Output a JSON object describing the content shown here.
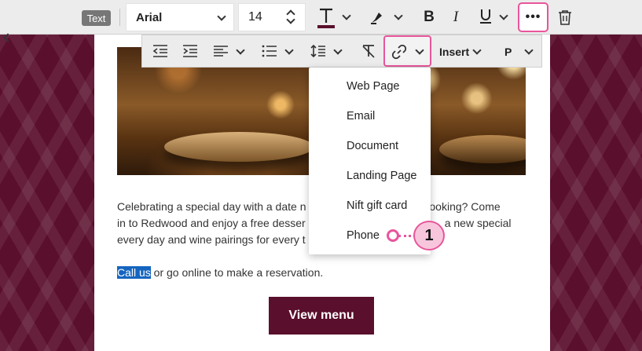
{
  "toolbar": {
    "text_badge": "Text",
    "font_family_value": "Arial",
    "font_size_value": "14",
    "more_label": "•••"
  },
  "toolbar2": {
    "insert_label": "Insert",
    "paragraph_label": "P"
  },
  "link_menu": {
    "items": [
      "Web Page",
      "Email",
      "Document",
      "Landing Page",
      "Nift gift card",
      "Phone"
    ]
  },
  "callout": {
    "number": "1"
  },
  "content": {
    "para1_line1": "Celebrating a special day with a date n",
    "para1_line1_end": "like cooking? Come",
    "para1_line2": "in to Redwood and enjoy a free desser",
    "para1_line2_end": "a new special",
    "para1_line3": "every day and wine pairings for every t",
    "selected_link_text": "Call us",
    "para2_rest": " or go online to make a reservation.",
    "cta_label": "View menu"
  },
  "colors": {
    "accent": "#e8559b",
    "brand": "#5a0f2c",
    "selection": "#1565c0"
  }
}
